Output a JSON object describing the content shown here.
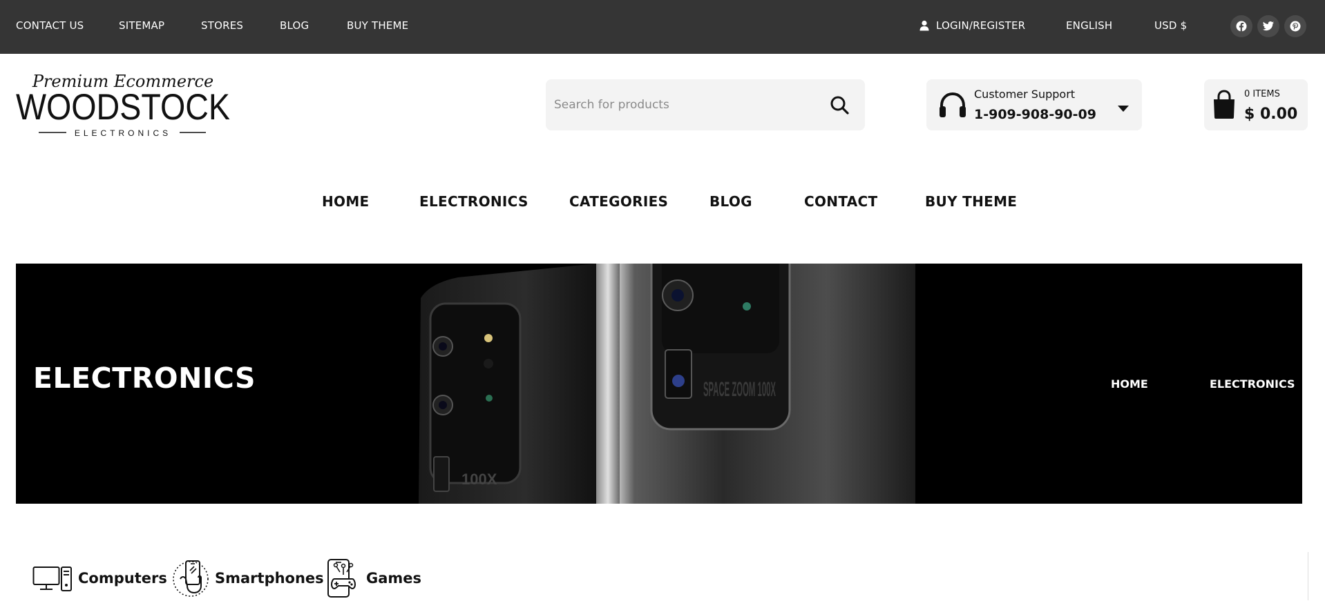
{
  "topbar": {
    "links": [
      "CONTACT US",
      "SITEMAP",
      "STORES",
      "BLOG",
      "BUY THEME"
    ],
    "login": "LOGIN/REGISTER",
    "language": "ENGLISH",
    "currency": "USD $",
    "social_icons": [
      "facebook-icon",
      "twitter-icon",
      "pinterest-icon"
    ]
  },
  "logo": {
    "tagline": "Premium Ecommerce",
    "name": "WOODSTOCK",
    "sub": "ELECTRONICS"
  },
  "search": {
    "placeholder": "Search for products"
  },
  "support": {
    "title": "Customer Support",
    "phone": "1-909-908-90-09"
  },
  "cart": {
    "items": "0 ITEMS",
    "total": "$ 0.00"
  },
  "nav": [
    "HOME",
    "ELECTRONICS",
    "CATEGORIES",
    "BLOG",
    "CONTACT",
    "BUY THEME"
  ],
  "hero": {
    "title": "ELECTRONICS",
    "breadcrumb": [
      "HOME",
      "ELECTRONICS"
    ],
    "phone_text": "SPACE ZOOM 100X"
  },
  "categories": [
    {
      "label": "Computers",
      "icon": "computer-icon"
    },
    {
      "label": "Smartphones",
      "icon": "smartphone-hand-icon"
    },
    {
      "label": "Games",
      "icon": "game-controller-icon"
    }
  ],
  "colors": {
    "topbar": "#353535",
    "hero": "#000000",
    "panel": "#f3f3f3"
  }
}
